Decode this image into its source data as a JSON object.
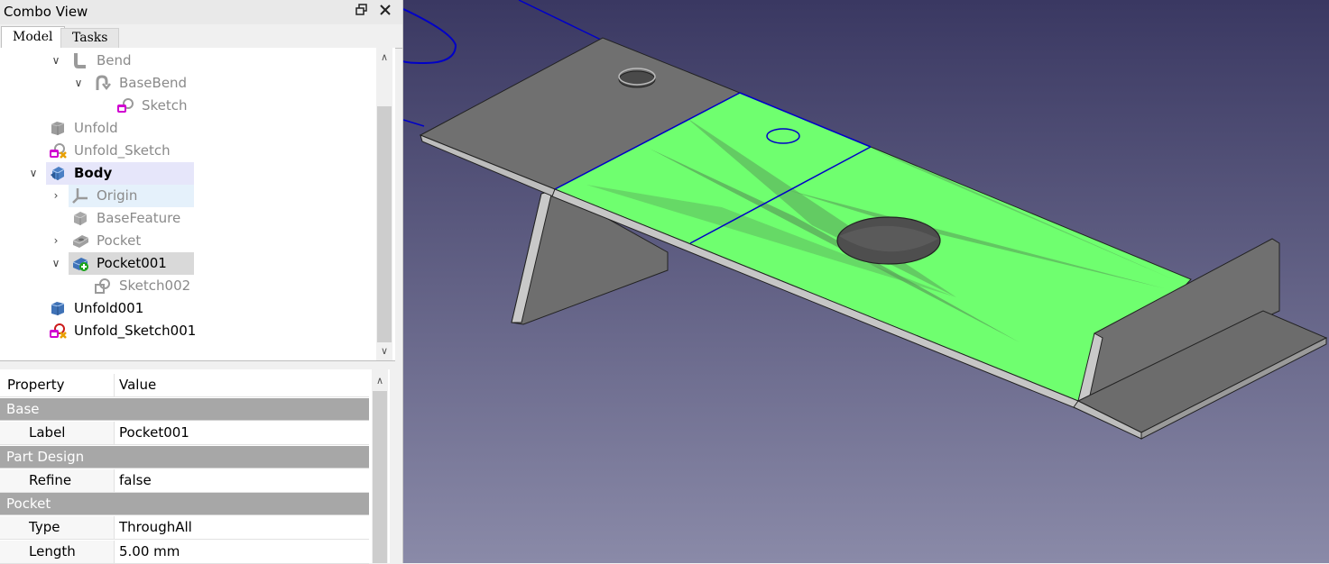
{
  "window": {
    "title": "Combo View",
    "float_icon": "float-window-icon",
    "close_icon": "close-icon"
  },
  "tabs": [
    {
      "label": "Model"
    },
    {
      "label": "Tasks"
    }
  ],
  "tree": [
    {
      "label": "Bend",
      "icon": "bend-icon",
      "expanded": true
    },
    {
      "label": "BaseBend",
      "icon": "basebend-icon",
      "expanded": true
    },
    {
      "label": "Sketch",
      "icon": "sketch-icon"
    },
    {
      "label": "Unfold",
      "icon": "unfold-icon"
    },
    {
      "label": "Unfold_Sketch",
      "icon": "unfold-sketch-icon"
    },
    {
      "label": "Body",
      "icon": "body-icon",
      "expanded": true,
      "active": true
    },
    {
      "label": "Origin",
      "icon": "origin-icon",
      "expanded": false
    },
    {
      "label": "BaseFeature",
      "icon": "basefeature-icon"
    },
    {
      "label": "Pocket",
      "icon": "pocket-icon",
      "expanded": false
    },
    {
      "label": "Pocket001",
      "icon": "pocket-tip-icon",
      "expanded": true,
      "selected": true
    },
    {
      "label": "Sketch002",
      "icon": "sketch-icon"
    },
    {
      "label": "Unfold001",
      "icon": "unfold-icon"
    },
    {
      "label": "Unfold_Sketch001",
      "icon": "unfold-sketch-icon"
    }
  ],
  "properties": {
    "header": {
      "property": "Property",
      "value": "Value"
    },
    "groups": [
      {
        "name": "Base",
        "rows": [
          {
            "name": "Label",
            "value": "Pocket001"
          }
        ]
      },
      {
        "name": "Part Design",
        "rows": [
          {
            "name": "Refine",
            "value": "false"
          }
        ]
      },
      {
        "name": "Pocket",
        "rows": [
          {
            "name": "Type",
            "value": "ThroughAll"
          },
          {
            "name": "Length",
            "value": "5.00 mm"
          }
        ]
      }
    ]
  },
  "colors": {
    "viewport_top": "#3a3862",
    "viewport_bottom": "#8a8aa8",
    "selection_green": "#6fff6f",
    "sheet_grey": "#6b6b6b",
    "edge_blue": "#0000c8",
    "group_bg": "#a7a7a7"
  }
}
